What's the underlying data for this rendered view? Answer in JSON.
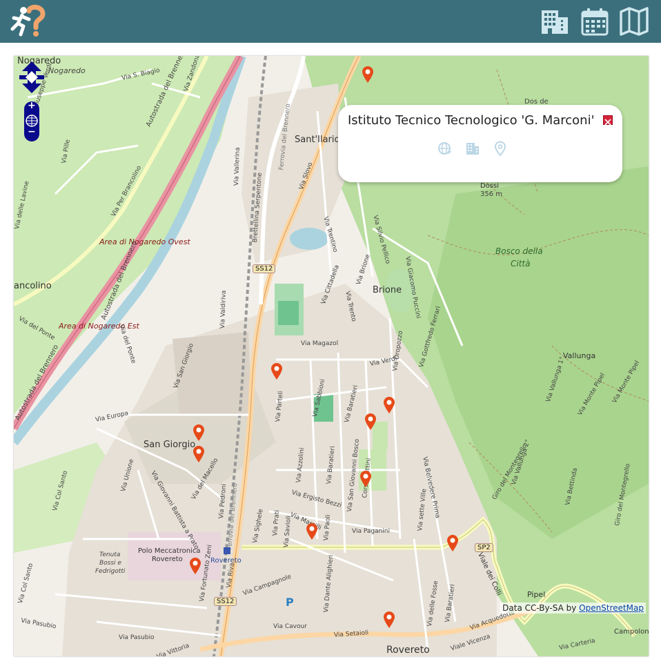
{
  "header": {
    "logo_icon": "runner-question-icon",
    "buttons": [
      {
        "name": "buildings-view-button",
        "icon": "building-icon"
      },
      {
        "name": "calendar-view-button",
        "icon": "calendar-icon"
      },
      {
        "name": "map-view-button",
        "icon": "map-icon"
      }
    ],
    "colors": {
      "bar": "#3b6f7c",
      "icon": "#cfe7ee"
    }
  },
  "map": {
    "places": {
      "nogaredo": "Nogaredo",
      "nogaredo_italic": "Nogaredo",
      "sant_ilario": "Sant'Ilario",
      "brione": "Brione",
      "san_giorgio": "San Giorgio",
      "rovereto": "Rovereto",
      "rovereto_station": "Rovereto",
      "vallunga": "Vallunga",
      "pipel": "Pipel",
      "campolong": "Campolong",
      "dossi": "Dossi",
      "dossi_alt": "356 m",
      "ancolino": "ancolino",
      "dos_de": "Dos de"
    },
    "areas": {
      "nogaredo_ovest": "Area di Nogaredo Ovest",
      "nogaredo_est": "Area di Nogaredo Est",
      "bosco_1": "Bosco della",
      "bosco_2": "Città",
      "polo_1": "Polo Meccatronica",
      "polo_2": "Rovereto",
      "tenuta_1": "Tenuta",
      "tenuta_2": "Bossi e",
      "tenuta_3": "Fedrigotti"
    },
    "roads": {
      "autostrada_1": "Autostrada del Brennero",
      "autostrada_2": "Autostrada del Brennero",
      "autostrada_3": "Autostrada del Brennero",
      "autostrada_4": "Autostrada del Brennero",
      "per_brancolino": "Via Per Brancolino",
      "s_biagio": "Via S. Biagio",
      "zandonai": "Via Zandonai",
      "verdi_n": "Via Giuseppe Verdi",
      "pille": "Via Pille",
      "lavine": "Via delle Lavine",
      "del_ponte": "Via del Ponte",
      "del_ponte2": "Via del Ponte",
      "vallerina": "Via Vallerina",
      "brettellina": "Brettellina Serpentone",
      "ferrovia_n": "Ferrovia del Brennero",
      "ferrovia_s": "Ferrovia del Brennero",
      "valdiriva": "Via Valdiriva",
      "cittadella": "Via Cittadella",
      "magazol": "Via Magazol",
      "san_giorgio_rd": "Via San Giorgio",
      "europa": "Via Europa",
      "unione": "Via Unione",
      "col_santo": "Via Col Santo",
      "col_santo2": "Via Col Santo",
      "pasubio": "Via Pasubio",
      "pasubio2": "Via Pasubio",
      "vittoria": "Via Vittoria",
      "fortunato_zeni": "Via Fortunato Zeni",
      "campagnole": "Via Campagnole",
      "riva": "Via Riva",
      "pedroni": "Via Pedroni",
      "del_macello": "Via del Macello",
      "giovanni_prato": "Via Giovanni Battista a Prato",
      "sighele": "Via Sighele",
      "prati": "Via Prati",
      "savioli": "Via Savioli",
      "marsilli": "Via Marsilli",
      "ergisto_bezzi": "Via Ergisto Bezzi",
      "azzolini": "Via Azzolini",
      "parteli": "Via Parteli",
      "sabbioni": "Via Sabbioni",
      "baratieri": "Via Baratieri",
      "baratieri2": "Via Baratieri",
      "san_giovanni_bosco": "Via San Giovanni Bosco",
      "corso_bettini": "Corso Bettini",
      "paolo": "Via Paoli",
      "paganini": "Via Paganini",
      "dante": "Via Dante Alighieri",
      "setaioli": "Via Setaioli",
      "vicenza": "Viale Vicenza",
      "colli": "Viale dei Colli",
      "acquedotto": "Via Acquedotto",
      "baratieri_s": "Via Baratieri",
      "delle_fosse": "Via delle Fosse",
      "sette_ville": "Via sette Ville",
      "belvedere": "Via Belvedere Prima",
      "giro_monte": "Giro del Montegrello",
      "brione_rd": "Via Brione",
      "trento": "Via Trento",
      "silvio_pellico": "Via Silvio Pellico",
      "giacomo_puccini": "Via Giacomo Puccini",
      "gottfredo_ferrari": "Via Gottfredo Ferrari",
      "verdi_s": "Via Verdi",
      "dropozzo": "Via Dropozzo",
      "slovo": "Via Slovo",
      "trentino": "Via Trentino",
      "vallunga_2": "Via Vallunga 2°",
      "vallunga_1": "Via Vallunga 1°",
      "monte_pipel": "Via Monte Pipel",
      "monte_pipel2": "Via Monte Pipel",
      "bettinda": "Via Bettinda",
      "giro_montegrello2": "Giro del Montegrello",
      "carteria": "Via Carteria",
      "cavour": "Via Cavour",
      "ss12_a": "SS12",
      "ss12_b": "SS12",
      "sp2": "SP2"
    },
    "markers": [
      {
        "id": 1,
        "color": "#e64a19"
      },
      {
        "id": 2,
        "color": "#e64a19"
      },
      {
        "id": 3,
        "color": "#e64a19"
      },
      {
        "id": 4,
        "color": "#e64a19"
      },
      {
        "id": 5,
        "color": "#e64a19"
      },
      {
        "id": 6,
        "color": "#e64a19"
      },
      {
        "id": 7,
        "color": "#e64a19"
      },
      {
        "id": 8,
        "color": "#e64a19"
      },
      {
        "id": 9,
        "color": "#e64a19"
      },
      {
        "id": 10,
        "color": "#e64a19"
      },
      {
        "id": 11,
        "color": "#e64a19"
      },
      {
        "id": 12,
        "color": "#e64a19"
      }
    ],
    "controls": {
      "zoom_in": "+",
      "zoom_out": "−"
    },
    "attribution": {
      "prefix": "Data CC-By-SA by ",
      "link": "OpenStreetMap"
    }
  },
  "popup": {
    "title": "Istituto Tecnico Tecnologico 'G. Marconi'",
    "icons": [
      "globe-icon",
      "building-icon",
      "location-pin-icon"
    ],
    "icon_color": "#bcd6e6"
  }
}
